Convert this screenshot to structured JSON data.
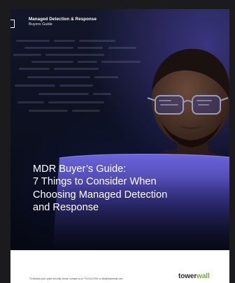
{
  "header": {
    "title": "Managed Detection & Response",
    "subtitle": "Buyers Guide"
  },
  "headline": {
    "lines": [
      "MDR Buyer’s Guide:",
      "7 Things to Consider When",
      "Choosing Managed Detection",
      "and Response"
    ]
  },
  "footer": {
    "contact": "To discuss your cyber security needs, contact us at  774.204.0700  or  info@towerwall.com",
    "logo_part_1": "tower",
    "logo_part_2": "wall"
  },
  "colors": {
    "background_navy": "#0c1020",
    "purple_glow": "#6a5ad8",
    "footer_background": "#ffffff",
    "brand_green": "#6fae2c",
    "brand_dark": "#2b2b2b"
  }
}
